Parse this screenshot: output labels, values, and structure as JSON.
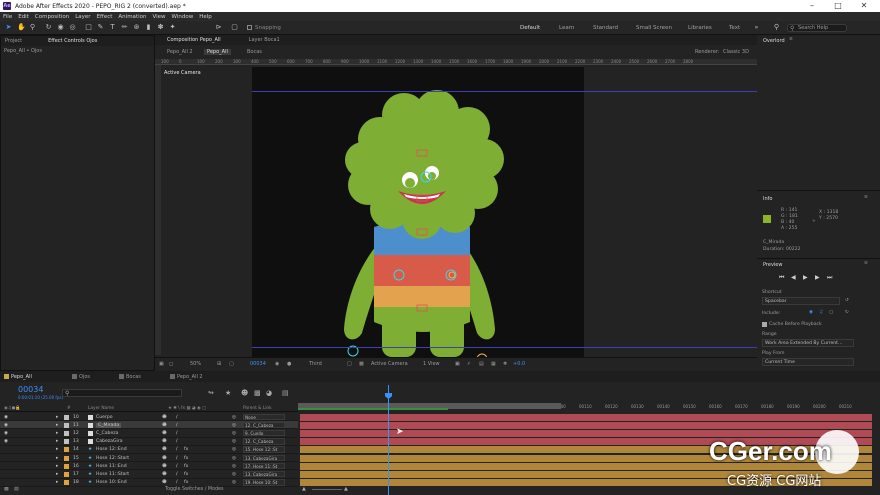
{
  "app": {
    "window_title": "Adobe After Effects 2020 - PEPO_RIG 2 (converted).aep *",
    "icon_label": "Ae"
  },
  "menu": [
    "File",
    "Edit",
    "Composition",
    "Layer",
    "Effect",
    "Animation",
    "View",
    "Window",
    "Help"
  ],
  "toolbar": {
    "snapping_label": "Snapping",
    "workspaces": [
      "Default",
      "Learn",
      "Standard",
      "Small Screen",
      "Libraries",
      "Text"
    ],
    "search_placeholder": "Search Help"
  },
  "project_panel": {
    "tabs": [
      "Project",
      "Effect Controls Ojos"
    ],
    "subtitle": "Pepo_All • Ojos"
  },
  "composition_panel": {
    "tab": "Composition Pepo_All",
    "layer_tab": "Layer Boca1",
    "breadcrumbs": [
      "Pepo_All 2",
      "Pepo_All",
      "Bocas"
    ],
    "renderer": "Renderer:",
    "renderer_value": "Classic 3D",
    "active_camera_label": "Active Camera",
    "ruler_ticks": [
      "100",
      "0",
      "100",
      "200",
      "300",
      "400",
      "500",
      "600",
      "700",
      "800",
      "900",
      "1000",
      "1100",
      "1200",
      "1300",
      "1400",
      "1500",
      "1600",
      "1700",
      "1800",
      "1900",
      "2000",
      "2100",
      "2200",
      "2300",
      "2400",
      "2500",
      "2600",
      "2700",
      "2800"
    ],
    "footer": {
      "zoom": "50%",
      "timecode": "00034",
      "view": "Third",
      "camera": "Active Camera",
      "views": "1 View",
      "exposure": "+0.0"
    }
  },
  "overlord_panel": {
    "title": "Overlord"
  },
  "info_panel": {
    "title": "Info",
    "r": "R : 141",
    "g": "G : 181",
    "b": "B : 40",
    "a": "A : 255",
    "x": "X : 1318",
    "y": "Y : 2570",
    "layer_name": "C_Mirada",
    "duration": "Duration: 00222",
    "swatch_color": "#8db528"
  },
  "preview_panel": {
    "title": "Preview",
    "shortcut_label": "Shortcut",
    "shortcut_value": "Spacebar",
    "include_label": "Include:",
    "cache_label": "Cache Before Playback",
    "range_label": "Range",
    "range_value": "Work Area Extended By Current...",
    "play_from_label": "Play From",
    "play_from_value": "Current Time"
  },
  "timeline": {
    "tabs": [
      {
        "label": "Pepo_All",
        "color": "#c9a84c"
      },
      {
        "label": "Ojos",
        "color": "#6a6a6a"
      },
      {
        "label": "Bocas",
        "color": "#6a6a6a"
      },
      {
        "label": "Pepo_All 2",
        "color": "#6a6a6a"
      }
    ],
    "current_time": "00034",
    "fps_label": "0:00:01:10 (25.00 fps)",
    "col_headers": {
      "num": "#",
      "name": "Layer Name",
      "parent": "Parent & Link"
    },
    "layers": [
      {
        "num": "10",
        "name": "Cuerpo",
        "label": "#c0c0c0",
        "parent": "None",
        "bar": "#b04a55"
      },
      {
        "num": "11",
        "name": "C_Mirada",
        "label": "#c0c0c0",
        "parent": "12. C_Cabeza",
        "bar": "#b04a55"
      },
      {
        "num": "12",
        "name": "C_Cabeza",
        "label": "#c0c0c0",
        "parent": "9. Cuello",
        "bar": "#b04a55"
      },
      {
        "num": "13",
        "name": "CabezaGira",
        "label": "#c0c0c0",
        "parent": "12. C_Cabeza",
        "bar": "#b04a55"
      },
      {
        "num": "14",
        "name": "Hose 12::End",
        "label": "#e0a040",
        "parent": "15. Hose 12::St",
        "bar": "#b0873a"
      },
      {
        "num": "15",
        "name": "Hose 12::Start",
        "label": "#e0a040",
        "parent": "13. CabezaGira",
        "bar": "#b0873a"
      },
      {
        "num": "16",
        "name": "Hose 11::End",
        "label": "#e0a040",
        "parent": "17. Hose 11::St",
        "bar": "#b0873a"
      },
      {
        "num": "17",
        "name": "Hose 11::Start",
        "label": "#e0a040",
        "parent": "13. CabezaGira",
        "bar": "#b0873a"
      },
      {
        "num": "18",
        "name": "Hose 10::End",
        "label": "#e0a040",
        "parent": "19. Hose 10::St",
        "bar": "#b0873a"
      }
    ],
    "ruler": [
      "00000",
      "00010",
      "00020",
      "00030",
      "00040",
      "00050",
      "00060",
      "00070",
      "00080",
      "00090",
      "00100",
      "00110",
      "00120",
      "00130",
      "00140",
      "00150",
      "00160",
      "00170",
      "00180",
      "00190",
      "00200",
      "00210"
    ],
    "footer_label": "Toggle Switches / Modes"
  },
  "watermark": {
    "line1": "CGer.com",
    "line2": "CG资源 CG网站"
  }
}
